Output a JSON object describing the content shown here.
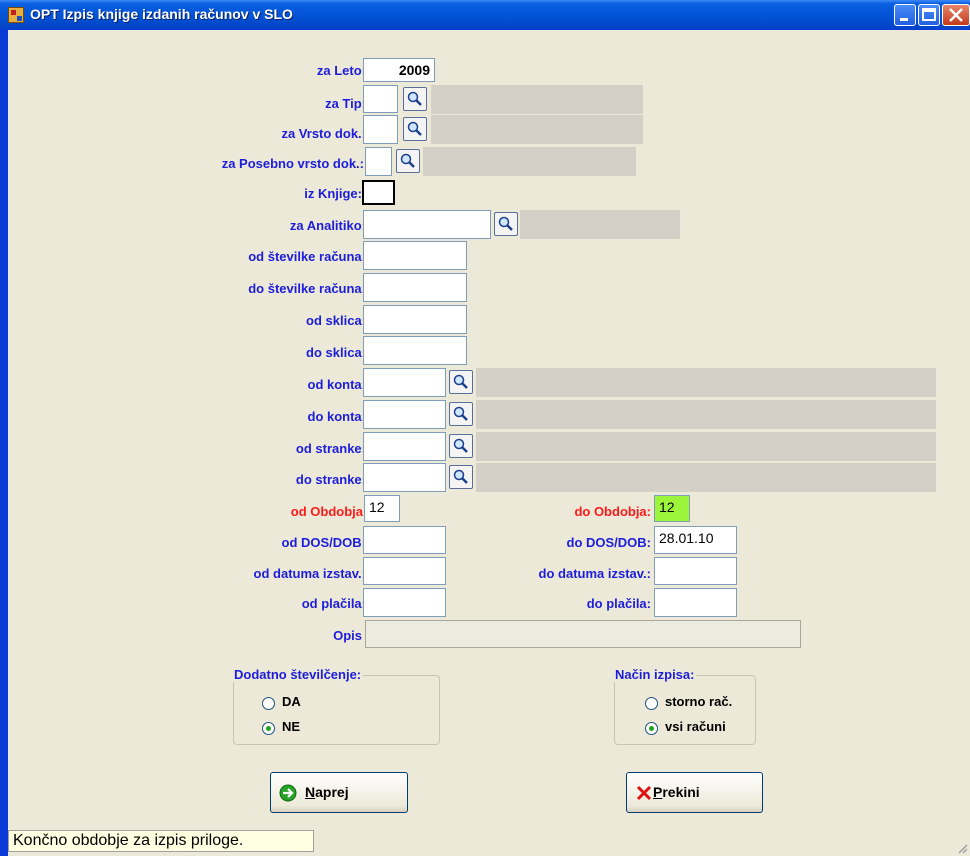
{
  "window": {
    "title": "OPT Izpis knjige izdanih računov v SLO"
  },
  "labels": {
    "za_leto": "za Leto:",
    "za_tip": "za Tip:",
    "za_vrsto_dok": "za Vrsto dok.:",
    "za_posebno_vrsto_dok": "za Posebno vrsto dok.:",
    "iz_knjige": "iz Knjige:",
    "za_analitiko": "za Analitiko:",
    "od_stevilke_racuna": "od številke računa:",
    "do_stevilke_racuna": "do številke računa:",
    "od_sklica": "od sklica:",
    "do_sklica": "do sklica:",
    "od_konta": "od konta:",
    "do_konta": "do konta:",
    "od_stranke": "od stranke:",
    "do_stranke": "do stranke:",
    "od_obdobja": "od Obdobja",
    "do_obdobja": "do Obdobja:",
    "od_dos_dob": "od DOS/DOB:",
    "do_dos_dob": "do DOS/DOB:",
    "od_datuma_izstav": "od datuma izstav.:",
    "do_datuma_izstav": "do datuma izstav.:",
    "od_placila": "od plačila:",
    "do_placila": "do plačila:",
    "opis": "Opis"
  },
  "values": {
    "za_leto": "2009",
    "od_obdobja": "12",
    "do_obdobja": "12",
    "do_dos_dob": "28.01.10"
  },
  "group_dodatno": {
    "title": "Dodatno številčenje:",
    "options": [
      {
        "label": "DA",
        "selected": false
      },
      {
        "label": "NE",
        "selected": true
      }
    ]
  },
  "group_nacin": {
    "title": "Način izpisa:",
    "options": [
      {
        "label": "storno rač.",
        "selected": false
      },
      {
        "label": "vsi računi",
        "selected": true
      }
    ]
  },
  "buttons": {
    "naprej": "Naprej",
    "prekini": "Prekini"
  },
  "status": {
    "text": "Končno obdobje za izpis priloge."
  },
  "colors": {
    "label_blue": "#1d1ddb",
    "label_red": "#ff1a1a",
    "active_field": "#9cf53a",
    "titlebar": "#0454d8"
  },
  "icons": {
    "lookup": "magnifier-icon",
    "naprej": "arrow-right-icon",
    "prekini": "x-icon"
  }
}
